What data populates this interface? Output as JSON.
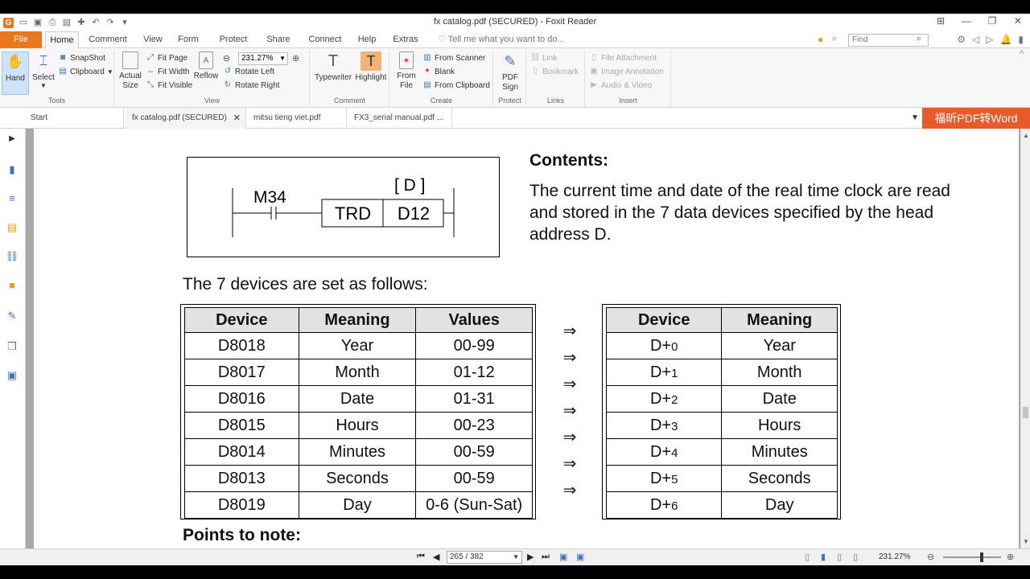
{
  "window": {
    "title": "fx catalog.pdf (SECURED) - Foxit Reader"
  },
  "ribbon_tabs": [
    "File",
    "Home",
    "Comment",
    "View",
    "Form",
    "Protect",
    "Share",
    "Connect",
    "Help",
    "Extras"
  ],
  "tell_me": "Tell me what you want to do...",
  "find_placeholder": "Find",
  "ribbon": {
    "tools": {
      "label": "Tools",
      "hand": "Hand",
      "select": "Select",
      "snapshot": "SnapShot",
      "clipboard": "Clipboard"
    },
    "view": {
      "label": "View",
      "actual_size": "Actual Size",
      "fit_page": "Fit Page",
      "fit_width": "Fit Width",
      "fit_visible": "Fit Visible",
      "reflow": "Reflow",
      "zoom": "231.27%",
      "rotate_left": "Rotate Left",
      "rotate_right": "Rotate Right"
    },
    "comment": {
      "label": "Comment",
      "typewriter": "Typewriter",
      "highlight": "Highlight"
    },
    "create": {
      "label": "Create",
      "from_file": "From File",
      "from_scanner": "From Scanner",
      "blank": "Blank",
      "from_clipboard": "From Clipboard"
    },
    "protect": {
      "label": "Protect",
      "pdf_sign": "PDF Sign"
    },
    "links": {
      "label": "Links",
      "link": "Link",
      "bookmark": "Bookmark"
    },
    "insert": {
      "label": "Insert",
      "file_attachment": "File Attachment",
      "image_annotation": "Image Annotation",
      "audio_video": "Audio & Video"
    }
  },
  "doc_tabs": [
    "Start",
    "fx catalog.pdf (SECURED)",
    "mitsu tieng viet.pdf",
    "FX3_serial manual.pdf ..."
  ],
  "promo": "福昕PDF转Word",
  "document": {
    "ladder": {
      "contact": "M34",
      "dest_label": "[ D ]",
      "instruction": "TRD",
      "operand": "D12"
    },
    "contents_heading": "Contents:",
    "contents_text": "The current time and date of the real time clock are read and stored in the 7 data devices specified by the head address D.",
    "devices_line": "The 7 devices are set as follows:",
    "table1": {
      "headers": [
        "Device",
        "Meaning",
        "Values"
      ],
      "rows": [
        [
          "D8018",
          "Year",
          "00-99"
        ],
        [
          "D8017",
          "Month",
          "01-12"
        ],
        [
          "D8016",
          "Date",
          "01-31"
        ],
        [
          "D8015",
          "Hours",
          "00-23"
        ],
        [
          "D8014",
          "Minutes",
          "00-59"
        ],
        [
          "D8013",
          "Seconds",
          "00-59"
        ],
        [
          "D8019",
          "Day",
          "0-6 (Sun-Sat)"
        ]
      ]
    },
    "arrow": "⇒",
    "table2": {
      "headers": [
        "Device",
        "Meaning"
      ],
      "rows": [
        [
          "D+",
          "0",
          "Year"
        ],
        [
          "D+",
          "1",
          "Month"
        ],
        [
          "D+",
          "2",
          "Date"
        ],
        [
          "D+",
          "3",
          "Hours"
        ],
        [
          "D+",
          "4",
          "Minutes"
        ],
        [
          "D+",
          "5",
          "Seconds"
        ],
        [
          "D+",
          "6",
          "Day"
        ]
      ]
    },
    "points_heading": "Points to note:"
  },
  "status": {
    "page": "265 / 382",
    "zoom": "231.27%"
  }
}
